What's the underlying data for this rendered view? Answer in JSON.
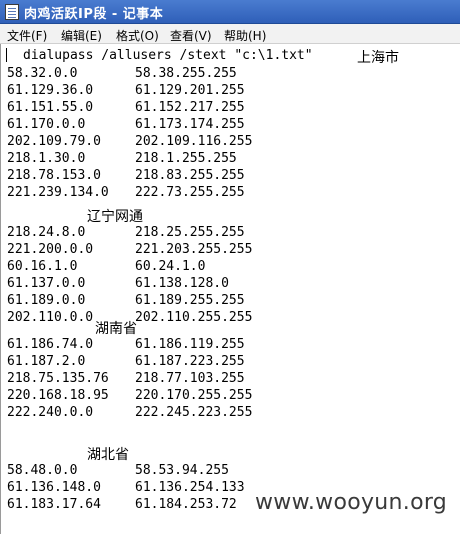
{
  "window": {
    "title": "肉鸡活跃IP段 - 记事本"
  },
  "menu": {
    "file": "文件(F)",
    "edit": "编辑(E)",
    "format": "格式(O)",
    "view": "查看(V)",
    "help": "帮助(H)"
  },
  "content": {
    "command": "dialupass /allusers /stext \"c:\\1.txt\"",
    "shanghai_heading": "上海市",
    "shanghai": [
      [
        "58.32.0.0",
        "58.38.255.255"
      ],
      [
        "61.129.36.0",
        "61.129.201.255"
      ],
      [
        "61.151.55.0",
        "61.152.217.255"
      ],
      [
        "61.170.0.0",
        "61.173.174.255"
      ],
      [
        "202.109.79.0",
        "202.109.116.255"
      ],
      [
        "218.1.30.0",
        "218.1.255.255"
      ],
      [
        "218.78.153.0",
        "218.83.255.255"
      ],
      [
        "221.239.134.0",
        "222.73.255.255"
      ]
    ],
    "liaoning_heading": "辽宁网通",
    "liaoning": [
      [
        "218.24.8.0",
        "218.25.255.255"
      ],
      [
        "221.200.0.0",
        "221.203.255.255"
      ],
      [
        "60.16.1.0",
        "60.24.1.0"
      ],
      [
        "61.137.0.0",
        "61.138.128.0"
      ],
      [
        "61.189.0.0",
        "61.189.255.255"
      ],
      [
        "202.110.0.0",
        "202.110.255.255"
      ]
    ],
    "hunan_heading": "湖南省",
    "hunan": [
      [
        "61.186.74.0",
        "61.186.119.255"
      ],
      [
        "61.187.2.0",
        "61.187.223.255"
      ],
      [
        "218.75.135.76",
        "218.77.103.255"
      ],
      [
        "220.168.18.95",
        "220.170.255.255"
      ],
      [
        "222.240.0.0",
        "222.245.223.255"
      ]
    ],
    "hubei_heading": "湖北省",
    "hubei": [
      [
        "58.48.0.0",
        "58.53.94.255"
      ],
      [
        "61.136.148.0",
        "61.136.254.133"
      ],
      [
        "61.183.17.64",
        "61.184.253.72"
      ]
    ]
  },
  "watermark": "www.wooyun.org"
}
